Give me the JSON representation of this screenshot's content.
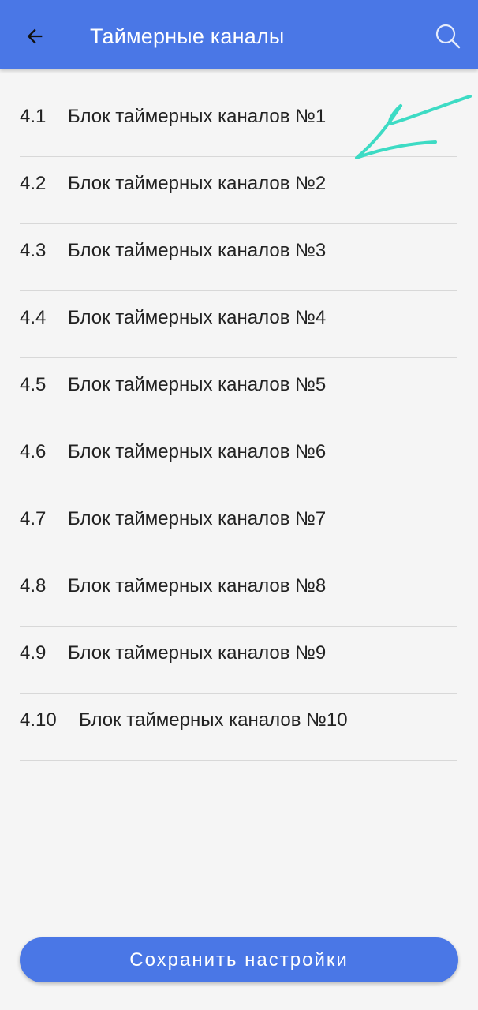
{
  "appbar": {
    "title": "Таймерные каналы",
    "back_icon": "arrow-left-icon",
    "search_icon": "search-icon",
    "color": "#4a77e6"
  },
  "list": {
    "items": [
      {
        "number": "4.1",
        "label": "Блок таймерных каналов №1"
      },
      {
        "number": "4.2",
        "label": "Блок таймерных каналов №2"
      },
      {
        "number": "4.3",
        "label": "Блок таймерных каналов №3"
      },
      {
        "number": "4.4",
        "label": "Блок таймерных каналов №4"
      },
      {
        "number": "4.5",
        "label": "Блок таймерных каналов №5"
      },
      {
        "number": "4.6",
        "label": "Блок таймерных каналов №6"
      },
      {
        "number": "4.7",
        "label": "Блок таймерных каналов №7"
      },
      {
        "number": "4.8",
        "label": "Блок таймерных каналов №8"
      },
      {
        "number": "4.9",
        "label": "Блок таймерных каналов №9"
      },
      {
        "number": "4.10",
        "label": "Блок таймерных каналов №10"
      }
    ]
  },
  "footer": {
    "save_label": "Сохранить настройки"
  },
  "annotation": {
    "type": "hand-drawn-arrow",
    "color": "#3ddbc4"
  }
}
